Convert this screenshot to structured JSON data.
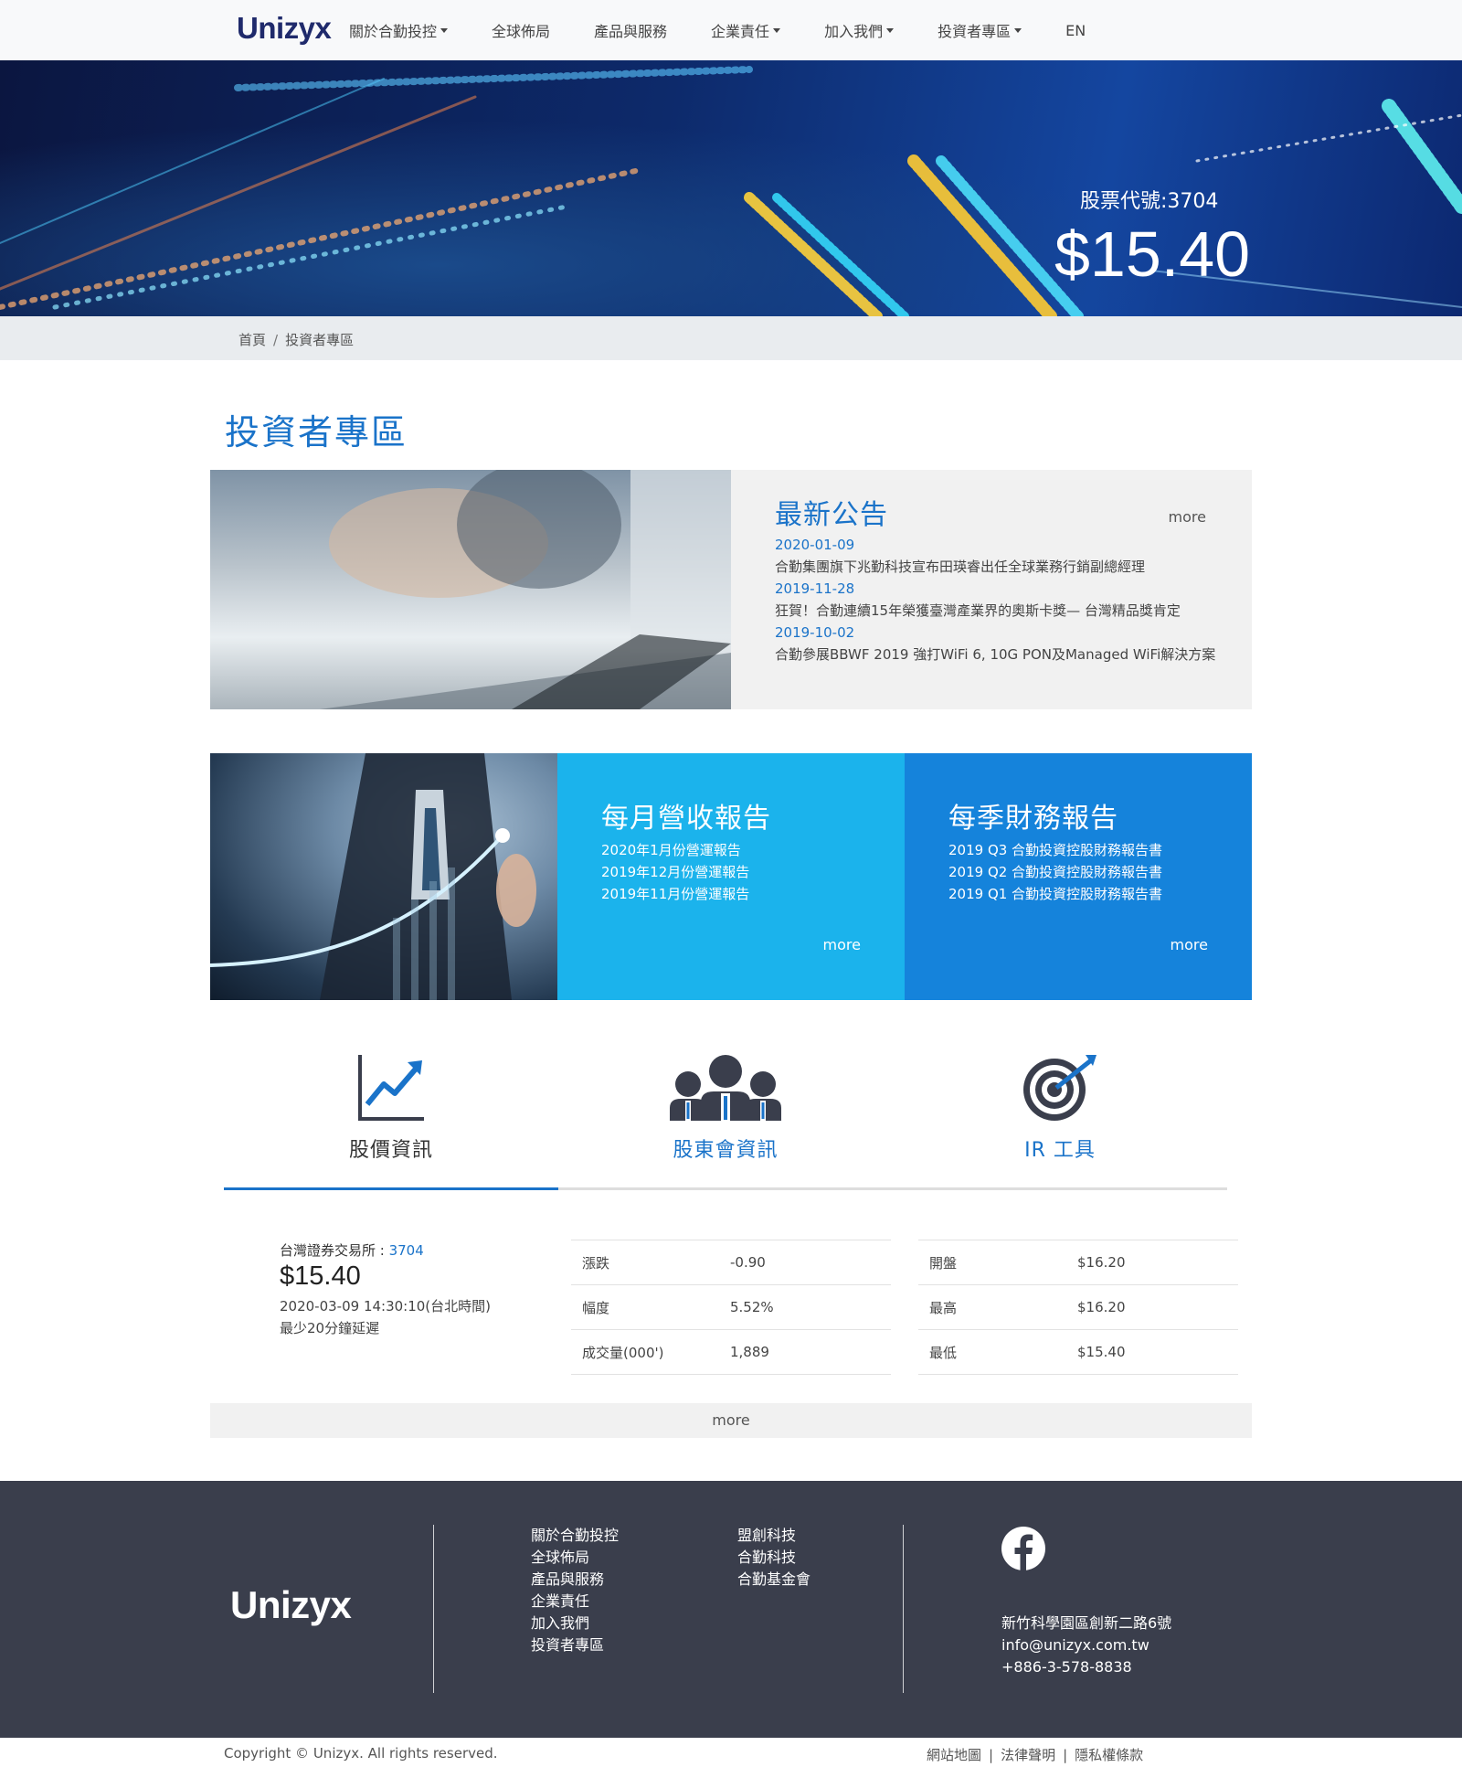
{
  "nav": {
    "logo": "Unizyx",
    "items": [
      {
        "label": "關於合勤投控",
        "dropdown": true
      },
      {
        "label": "全球佈局",
        "dropdown": false
      },
      {
        "label": "產品與服務",
        "dropdown": false
      },
      {
        "label": "企業責任",
        "dropdown": true
      },
      {
        "label": "加入我們",
        "dropdown": true
      },
      {
        "label": "投資者專區",
        "dropdown": true
      },
      {
        "label": "EN",
        "dropdown": false
      }
    ]
  },
  "hero": {
    "ticker_label": "股票代號:3704",
    "price": "$15.40"
  },
  "breadcrumb": {
    "home": "首頁",
    "separator": "/",
    "current": "投資者專區"
  },
  "page_title": "投資者專區",
  "news": {
    "title": "最新公告",
    "more": "more",
    "items": [
      {
        "date": "2020-01-09",
        "text": "合勤集團旗下兆勤科技宣布田瑛睿出任全球業務行銷副總經理"
      },
      {
        "date": "2019-11-28",
        "text": "狂賀！合勤連續15年榮獲臺灣產業界的奧斯卡獎— 台灣精品獎肯定"
      },
      {
        "date": "2019-10-02",
        "text": "合勤參展BBWF 2019 強打WiFi 6, 10G PON及Managed WiFi解決方案"
      }
    ]
  },
  "reports": {
    "monthly": {
      "title": "每月營收報告",
      "items": [
        "2020年1月份營運報告",
        "2019年12月份營運報告",
        "2019年11月份營運報告"
      ],
      "more": "more",
      "color": "#1bb3ec"
    },
    "quarterly": {
      "title": "每季財務報告",
      "items": [
        "2019 Q3 合勤投資控股財務報告書",
        "2019 Q2 合勤投資控股財務報告書",
        "2019 Q1 合勤投資控股財務報告書"
      ],
      "more": "more",
      "color": "#1583db"
    }
  },
  "tabs": [
    {
      "label": "股價資訊",
      "icon": "chart-up-icon",
      "active": true
    },
    {
      "label": "股東會資訊",
      "icon": "people-icon",
      "active": false
    },
    {
      "label": "IR 工具",
      "icon": "target-icon",
      "active": false
    }
  ],
  "stock": {
    "exchange_label": "台灣證券交易所 : ",
    "code": "3704",
    "price": "$15.40",
    "timestamp": "2020-03-09 14:30:10(台北時間)",
    "delay_note": "最少20分鐘延遲",
    "table_left": [
      {
        "label": "漲跌",
        "value": "-0.90"
      },
      {
        "label": "幅度",
        "value": "5.52%"
      },
      {
        "label": "成交量(000')",
        "value": "1,889"
      }
    ],
    "table_right": [
      {
        "label": "開盤",
        "value": "$16.20"
      },
      {
        "label": "最高",
        "value": "$16.20"
      },
      {
        "label": "最低",
        "value": "$15.40"
      }
    ],
    "more": "more"
  },
  "footer": {
    "logo": "Unizyx",
    "links_col1": [
      "關於合勤投控",
      "全球佈局",
      "產品與服務",
      "企業責任",
      "加入我們",
      "投資者專區"
    ],
    "links_col2": [
      "盟創科技",
      "合勤科技",
      "合勤基金會"
    ],
    "social_icon": "facebook-icon",
    "address": "新竹科學園區創新二路6號",
    "email": "info@unizyx.com.tw",
    "phone": "+886-3-578-8838",
    "copyright": "Copyright © Unizyx. All rights reserved.",
    "legal": [
      "網站地圖",
      "法律聲明",
      "隱私權條款"
    ],
    "legal_separator": "|"
  },
  "colors": {
    "accent": "#1a73c9",
    "monthly": "#1bb3ec",
    "quarterly": "#1583db",
    "footer_bg": "#3a3e4c"
  }
}
